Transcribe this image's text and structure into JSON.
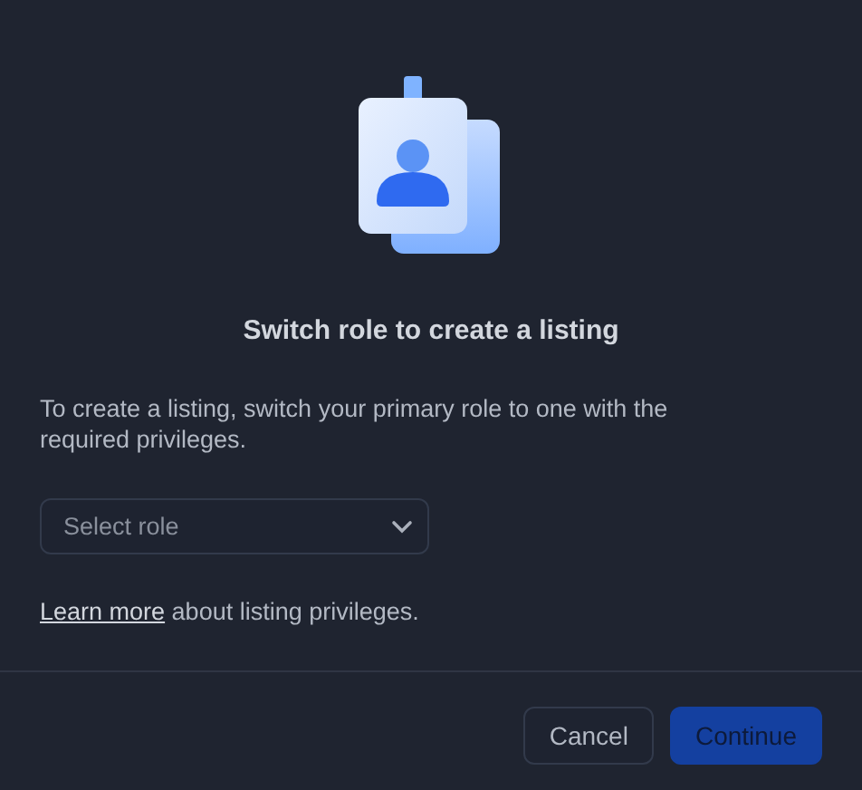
{
  "dialog": {
    "title": "Switch role to create a listing",
    "description": "To create a listing, switch your primary role to one with the required privileges.",
    "role_select": {
      "placeholder": "Select role"
    },
    "help": {
      "link": "Learn more",
      "text": " about listing privileges."
    },
    "buttons": [
      {
        "label": "Cancel",
        "kind": "secondary",
        "disabled": false
      },
      {
        "label": "Continue",
        "kind": "primary",
        "disabled": true
      }
    ]
  }
}
